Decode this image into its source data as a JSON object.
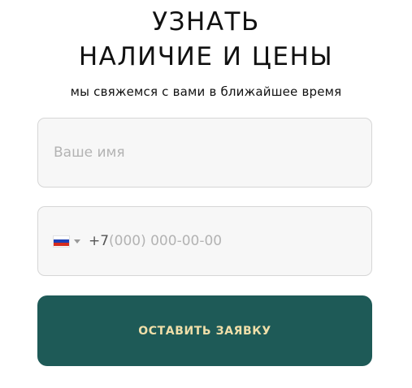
{
  "form": {
    "title_line_1": "УЗНАТЬ",
    "title_line_2": "НАЛИЧИЕ И ЦЕНЫ",
    "subtitle": "мы свяжемся с вами в ближайшее время",
    "name_field": {
      "value": "",
      "placeholder": "Ваше имя"
    },
    "phone_field": {
      "country": "ru-flag-icon",
      "dial_code": "+7",
      "value": "",
      "placeholder": "(000) 000-00-00"
    },
    "submit_label": "ОСТАВИТЬ ЗАЯВКУ"
  },
  "colors": {
    "button_bg": "#1e5a57",
    "button_text": "#f0dfa9",
    "field_bg": "#f7f7f7",
    "field_border": "#d6d6d6"
  }
}
